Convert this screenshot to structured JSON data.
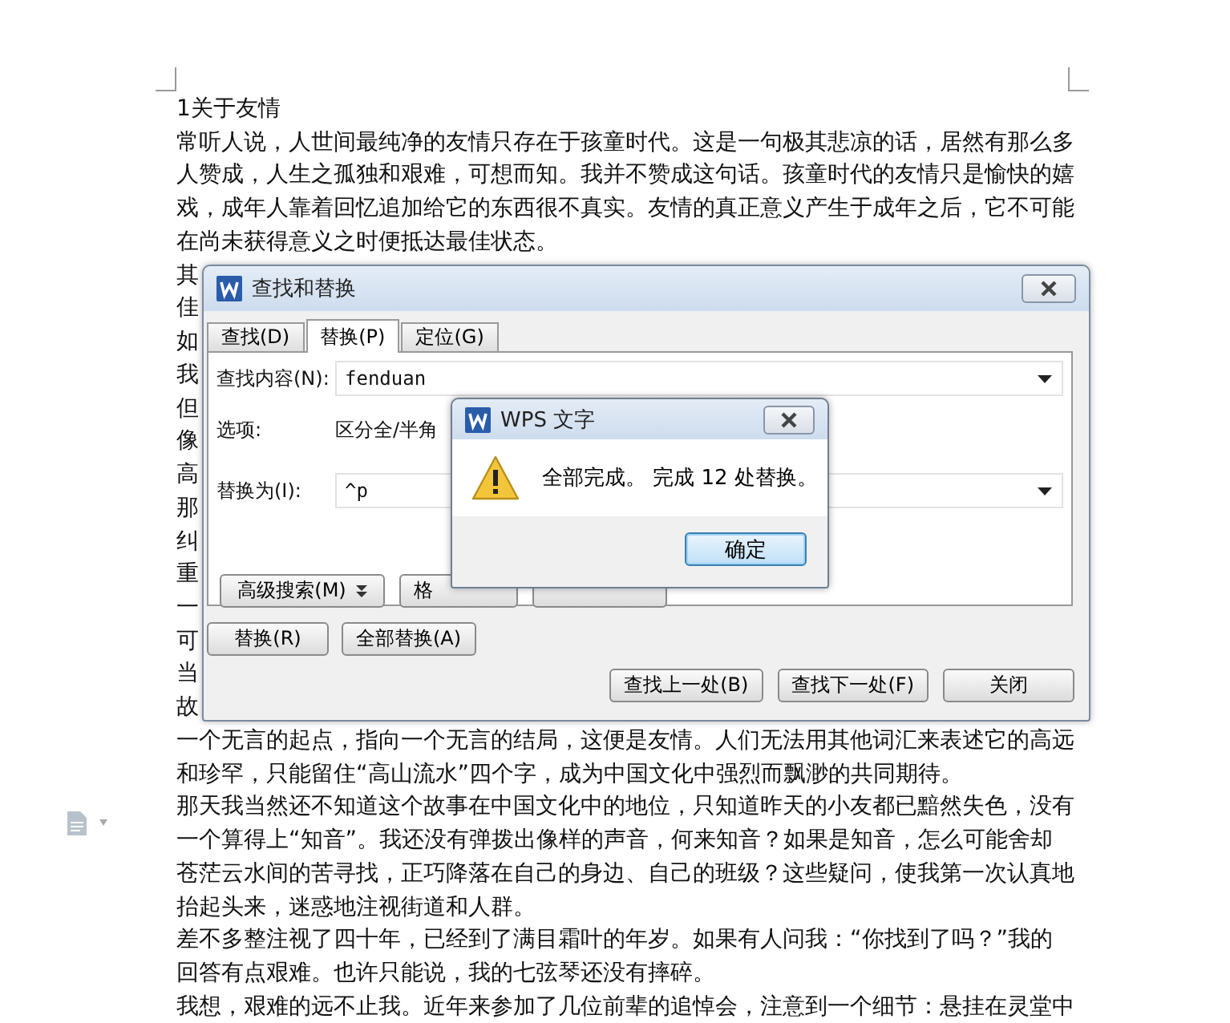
{
  "document": {
    "title": "1关于友情",
    "paragraphs": [
      {
        "lines": [
          "常听人说，人世间最纯净的友情只存在于孩童时代。这是一句极其悲凉的话，居然有那么多",
          "人赞成，人生之孤独和艰难，可想而知。我并不赞成这句话。孩童时代的友情只是愉快的嬉",
          "戏，成年人靠着回忆追加给它的东西很不真实。友情的真正意义产生于成年之后，它不可能",
          "在尚未获得意义之时便抵达最佳状态。"
        ]
      }
    ],
    "covered_line_starts": [
      "其",
      "佳",
      "如",
      "我",
      "但",
      "像",
      "高",
      "那",
      "纠",
      "重",
      "一",
      "可",
      "当",
      "故"
    ],
    "more_paragraphs": [
      {
        "lines": [
          "一个无言的起点，指向一个无言的结局，这便是友情。人们无法用其他词汇来表述它的高远",
          "和珍罕，只能留住“高山流水”四个字，成为中国文化中强烈而飘渺的共同期待。"
        ]
      },
      {
        "lines": [
          "那天我当然还不知道这个故事在中国文化中的地位，只知道昨天的小友都已黯然失色，没有",
          "一个算得上“知音”。我还没有弹拨出像样的声音，何来知音？如果是知音，怎么可能舍却",
          "苍茫云水间的苦寻找，正巧降落在自己的身边、自己的班级？这些疑问，使我第一次认真地",
          "抬起头来，迷惑地注视街道和人群。"
        ]
      },
      {
        "lines": [
          "差不多整注视了四十年，已经到了满目霜叶的年岁。如果有人问我：“你找到了吗？”我的",
          "回答有点艰难。也许只能说，我的七弦琴还没有摔碎。"
        ]
      },
      {
        "lines": [
          "我想，艰难的远不止我。近年来参加了几位前辈的追悼会，注意到一个细节：悬挂在灵堂中"
        ]
      }
    ]
  },
  "find_replace_dialog": {
    "title": "查找和替换",
    "tabs": [
      {
        "label": "查找(D)",
        "selected": false
      },
      {
        "label": "替换(P)",
        "selected": true
      },
      {
        "label": "定位(G)",
        "selected": false
      }
    ],
    "find": {
      "label": "查找内容(N):",
      "value": "fenduan"
    },
    "options": {
      "label": "选项:",
      "value": "区分全/半角"
    },
    "replace": {
      "label": "替换为(I):",
      "value": "^p"
    },
    "panel_buttons": [
      "高级搜索(M)",
      "格"
    ],
    "action_buttons": [
      "替换(R)",
      "全部替换(A)"
    ],
    "footer_buttons": [
      "查找上一处(B)",
      "查找下一处(F)",
      "关闭"
    ]
  },
  "message_box": {
    "title": "WPS 文字",
    "message": "全部完成。 完成 12 处替换。",
    "button": "确定"
  }
}
